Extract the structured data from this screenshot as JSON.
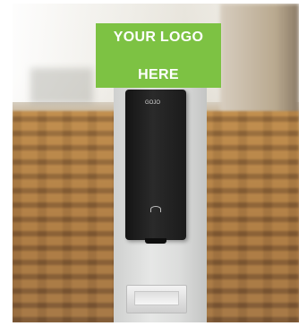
{
  "logo_panel": {
    "line1": "YOUR LOGO",
    "line2": "HERE"
  },
  "dispenser": {
    "brand_label": "GOJO"
  }
}
